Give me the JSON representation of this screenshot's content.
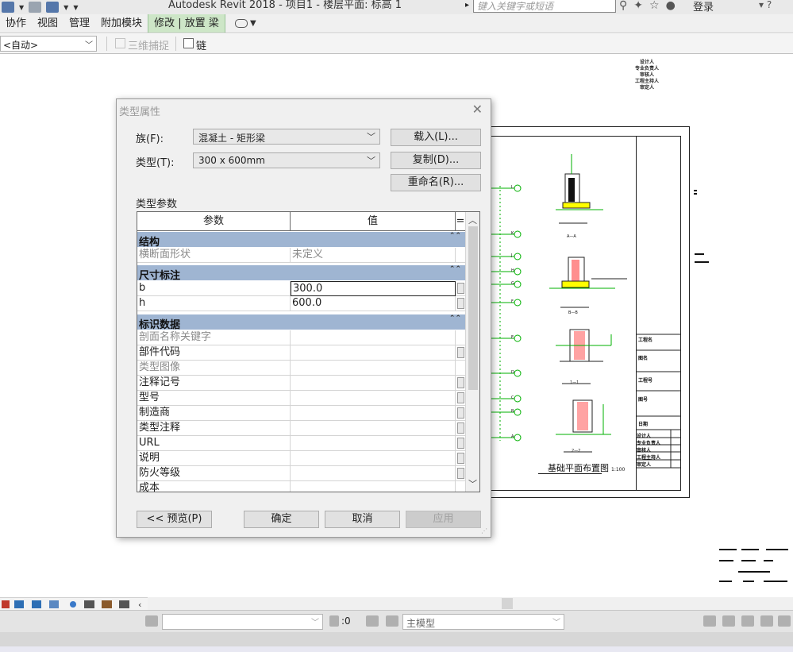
{
  "titlebar": {
    "app_title": "Autodesk Revit 2018 -   项目1 - 楼层平面: 标高 1",
    "search_placeholder": "键入关键字或短语",
    "login_label": "登录"
  },
  "ribbon": {
    "tabs": [
      {
        "label": "协作"
      },
      {
        "label": "视图"
      },
      {
        "label": "管理"
      },
      {
        "label": "附加模块"
      },
      {
        "label": "修改 | 放置 梁"
      }
    ],
    "active_tab": 4
  },
  "options_bar": {
    "level_value": "<自动>",
    "snap_3d_label": "三维捕捉",
    "chain_label": "链"
  },
  "dialog": {
    "title": "类型属性",
    "family_label": "族(F):",
    "family_value": "混凝土 - 矩形梁",
    "type_label": "类型(T):",
    "type_value": "300 x 600mm",
    "load_button": "载入(L)...",
    "duplicate_button": "复制(D)...",
    "rename_button": "重命名(R)...",
    "type_params_label": "类型参数",
    "columns": {
      "param": "参数",
      "value": "值",
      "eq": "="
    },
    "groups": [
      {
        "name": "结构",
        "rows": [
          {
            "param": "横断面形状",
            "value": "未定义",
            "gray": true
          }
        ]
      },
      {
        "name": "尺寸标注",
        "rows": [
          {
            "param": "b",
            "value": "300.0",
            "gray": false
          },
          {
            "param": "h",
            "value": "600.0",
            "gray": false
          }
        ]
      },
      {
        "name": "标识数据",
        "rows": [
          {
            "param": "剖面名称关键字",
            "value": "",
            "gray": true
          },
          {
            "param": "部件代码",
            "value": "",
            "gray": false
          },
          {
            "param": "类型图像",
            "value": "",
            "gray": true
          },
          {
            "param": "注释记号",
            "value": "",
            "gray": false
          },
          {
            "param": "型号",
            "value": "",
            "gray": false
          },
          {
            "param": "制造商",
            "value": "",
            "gray": false
          },
          {
            "param": "类型注释",
            "value": "",
            "gray": false
          },
          {
            "param": "URL",
            "value": "",
            "gray": false
          },
          {
            "param": "说明",
            "value": "",
            "gray": false
          },
          {
            "param": "防火等级",
            "value": "",
            "gray": false
          },
          {
            "param": "成本",
            "value": "",
            "gray": false
          }
        ]
      }
    ],
    "preview_button": "<< 预览(P)",
    "ok_button": "确定",
    "cancel_button": "取消",
    "apply_button": "应用"
  },
  "drawing": {
    "plan_title": "基础平面布置图",
    "plan_scale": "1:100",
    "approvals": [
      "设计人",
      "专业负责人",
      "审核人",
      "工程主持人",
      "审定人"
    ],
    "axis_labels": [
      "L",
      "K",
      "J",
      "H",
      "G",
      "F",
      "E",
      "D",
      "C",
      "B",
      "A"
    ],
    "section_labels": [
      "A—A",
      "B—B",
      "1—1",
      "2—2"
    ],
    "titleblock": [
      "工程名",
      "图名",
      "工程号",
      "图号",
      "日期"
    ],
    "titleblock_bottom": [
      "设计人",
      "专业负责人",
      "审核人",
      "工程主持人",
      "审定人"
    ]
  },
  "statusbar": {
    "selection_count": ":0",
    "model_value": "主模型"
  }
}
